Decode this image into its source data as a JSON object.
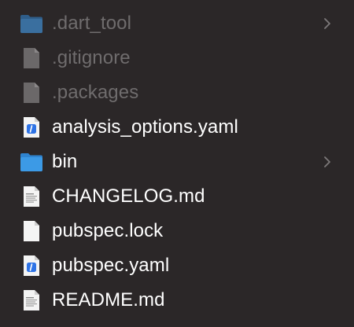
{
  "files": [
    {
      "name": ".dart_tool",
      "icon": "folder-icon",
      "hidden": true,
      "expandable": true
    },
    {
      "name": ".gitignore",
      "icon": "generic-file-icon",
      "hidden": true,
      "expandable": false
    },
    {
      "name": ".packages",
      "icon": "generic-file-icon",
      "hidden": true,
      "expandable": false
    },
    {
      "name": "analysis_options.yaml",
      "icon": "yaml-file-icon",
      "hidden": false,
      "expandable": false
    },
    {
      "name": "bin",
      "icon": "folder-icon",
      "hidden": false,
      "expandable": true
    },
    {
      "name": "CHANGELOG.md",
      "icon": "text-document-icon",
      "hidden": false,
      "expandable": false
    },
    {
      "name": "pubspec.lock",
      "icon": "blank-file-icon",
      "hidden": false,
      "expandable": false
    },
    {
      "name": "pubspec.yaml",
      "icon": "yaml-file-icon",
      "hidden": false,
      "expandable": false
    },
    {
      "name": "README.md",
      "icon": "text-document-icon",
      "hidden": false,
      "expandable": false
    }
  ],
  "colors": {
    "background": "#2b2728",
    "folder": "#3c92de",
    "text": "#ffffff",
    "hidden_text": "#6f6c6d"
  }
}
